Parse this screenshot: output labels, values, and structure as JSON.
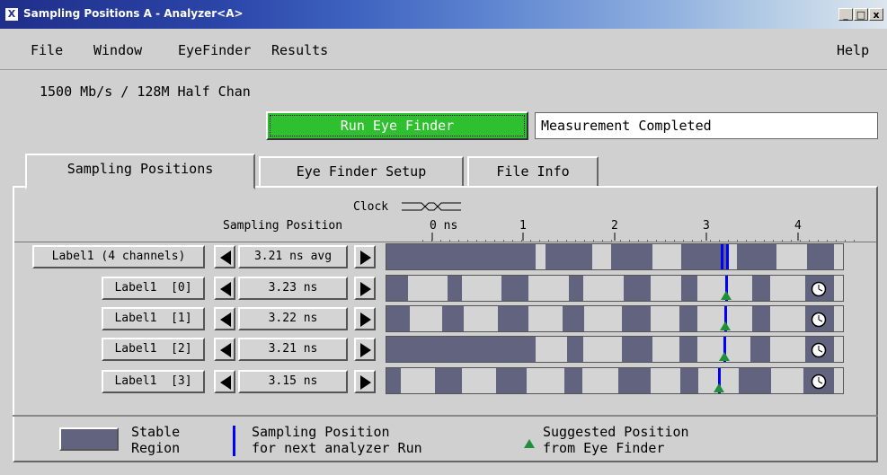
{
  "window": {
    "title": "Sampling Positions A - Analyzer<A>",
    "app_icon": "X",
    "minimize_icon": "minimize-icon",
    "maximize_icon": "maximize-icon",
    "close_icon": "close-icon"
  },
  "menu": {
    "file": "File",
    "window": "Window",
    "eyefinder": "EyeFinder",
    "results": "Results",
    "help": "Help"
  },
  "rate_text": "1500 Mb/s / 128M Half Chan",
  "run_button": "Run Eye Finder",
  "status_text": "Measurement Completed",
  "tabs": [
    "Sampling Positions",
    "Eye Finder Setup",
    "File Info"
  ],
  "header": {
    "clock_label": "Clock",
    "sampling_position_label": "Sampling Position",
    "ticks": [
      "0 ns",
      "1",
      "2",
      "3",
      "4"
    ]
  },
  "rows": [
    {
      "label": "Label1 (4 channels)",
      "value": "3.21 ns avg"
    },
    {
      "label": "Label1  [0]",
      "value": "3.23 ns"
    },
    {
      "label": "Label1  [1]",
      "value": "3.22 ns"
    },
    {
      "label": "Label1  [2]",
      "value": "3.21 ns"
    },
    {
      "label": "Label1  [3]",
      "value": "3.15 ns"
    }
  ],
  "legend": {
    "stable": "Stable\nRegion",
    "sampling": "Sampling Position\nfor next analyzer Run",
    "suggested": "Suggested Position\nfrom Eye Finder"
  },
  "colors": {
    "run_button": "#2ec02e",
    "stable_region": "#62637e",
    "sampling_marker": "#0000ff",
    "suggested_marker": "#1f8f3a"
  }
}
